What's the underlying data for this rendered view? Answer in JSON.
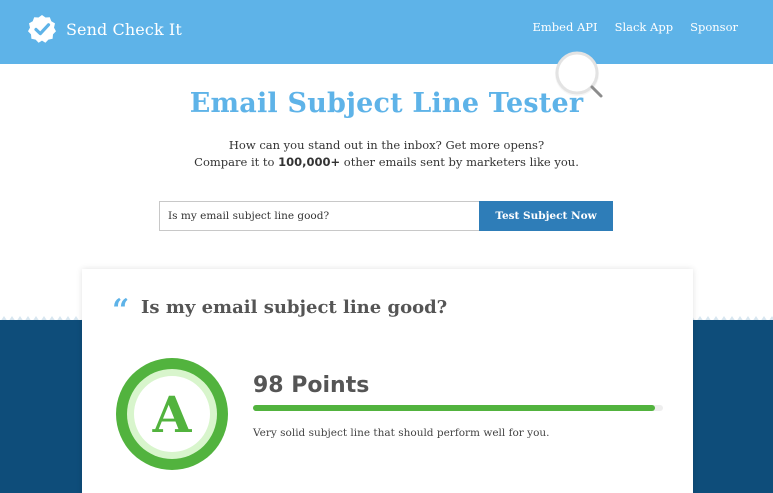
{
  "header": {
    "brand_name": "Send Check It",
    "nav": [
      {
        "label": "Embed API"
      },
      {
        "label": "Slack App"
      },
      {
        "label": "Sponsor"
      }
    ]
  },
  "hero": {
    "title": "Email Subject Line Tester",
    "subtitle_line1": "How can you stand out in the inbox? Get more opens?",
    "subtitle_line2_prefix": "Compare it to ",
    "subtitle_line2_bold": "100,000+",
    "subtitle_line2_suffix": " other emails sent by marketers like you."
  },
  "form": {
    "input_value": "Is my email subject line good?",
    "button_label": "Test Subject Now"
  },
  "result": {
    "quote_mark": "“",
    "subject": "Is my email subject line good?",
    "grade": "A",
    "points_label": "98 Points",
    "score": 98,
    "score_max": 100,
    "verdict": "Very solid subject line that should perform well for you."
  },
  "colors": {
    "header_bg": "#5eb3e8",
    "accent_blue": "#5eb3e8",
    "button_bg": "#2e7db8",
    "dark_band": "#0e4d7a",
    "grade_green": "#52b33e",
    "grade_light": "#d8f5cc"
  },
  "icons": {
    "logo": "checkmark-badge-icon",
    "decoration": "magnifier-icon"
  }
}
